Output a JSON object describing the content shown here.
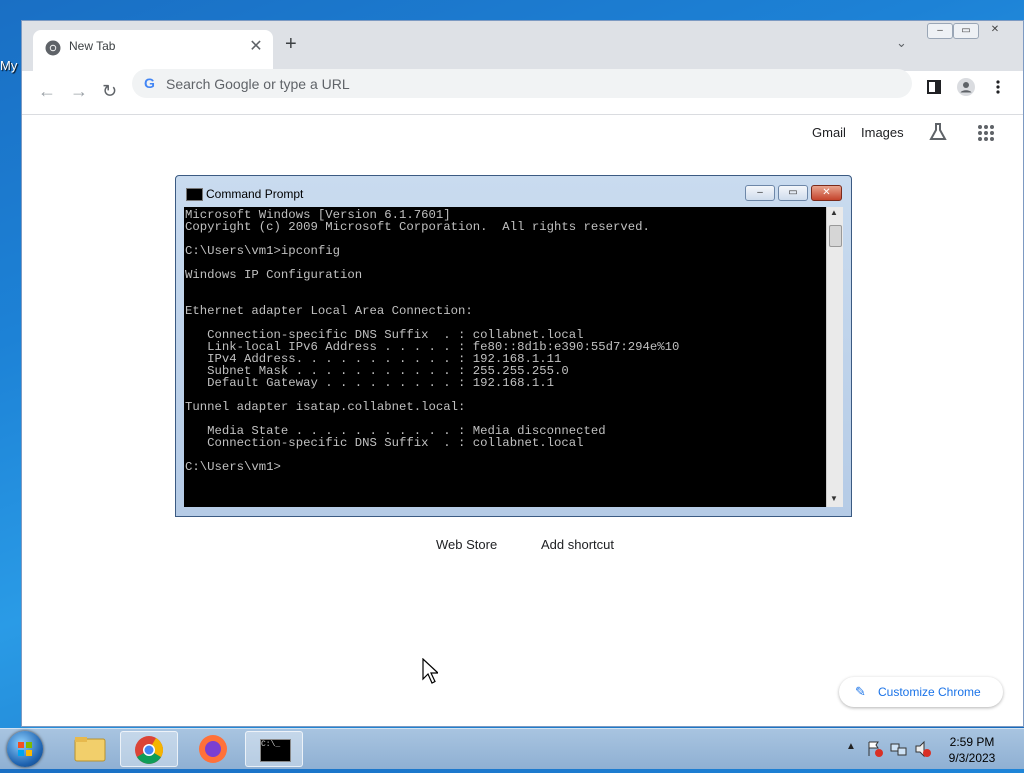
{
  "desktop": {
    "partial_label": "My"
  },
  "browser": {
    "tab_title": "New Tab",
    "tab_close": "✕",
    "new_tab": "+",
    "tab_search": "⌄",
    "omnibox_placeholder": "Search Google or type a URL",
    "toplinks": {
      "gmail": "Gmail",
      "images": "Images"
    },
    "shortcuts": {
      "web_store": "Web Store",
      "add_shortcut": "Add shortcut"
    },
    "customize_label": "Customize Chrome"
  },
  "cmd": {
    "title": "Command Prompt",
    "output": "Microsoft Windows [Version 6.1.7601]\nCopyright (c) 2009 Microsoft Corporation.  All rights reserved.\n\nC:\\Users\\vm1>ipconfig\n\nWindows IP Configuration\n\n\nEthernet adapter Local Area Connection:\n\n   Connection-specific DNS Suffix  . : collabnet.local\n   Link-local IPv6 Address . . . . . : fe80::8d1b:e390:55d7:294e%10\n   IPv4 Address. . . . . . . . . . . : 192.168.1.11\n   Subnet Mask . . . . . . . . . . . : 255.255.255.0\n   Default Gateway . . . . . . . . . : 192.168.1.1\n\nTunnel adapter isatap.collabnet.local:\n\n   Media State . . . . . . . . . . . : Media disconnected\n   Connection-specific DNS Suffix  . : collabnet.local\n\nC:\\Users\\vm1>"
  },
  "taskbar": {
    "time": "2:59 PM",
    "date": "9/3/2023",
    "cmd_icon_text": "C:\\_"
  },
  "colors": {
    "accent": "#1a73e8",
    "taskbar": "#9bb9d9",
    "desktop": "#1d82d6"
  }
}
